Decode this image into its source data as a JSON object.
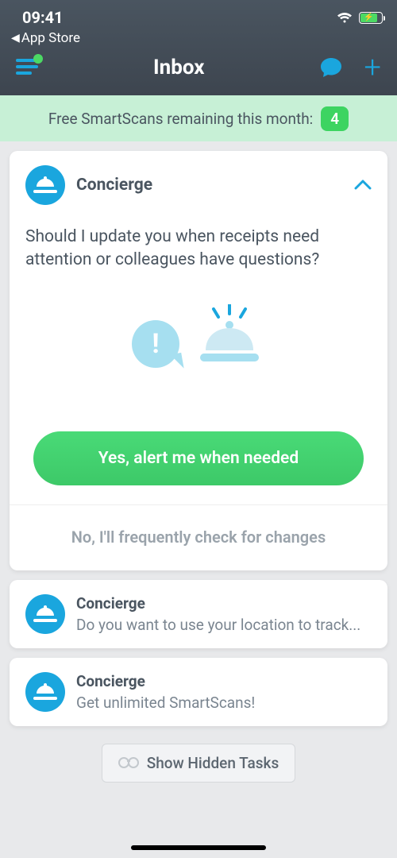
{
  "status": {
    "time": "09:41"
  },
  "back": {
    "label": "App Store"
  },
  "nav": {
    "title": "Inbox"
  },
  "banner": {
    "text": "Free SmartScans remaining this month:",
    "count": "4"
  },
  "card1": {
    "sender": "Concierge",
    "question": "Should I update you when receipts need attention or colleagues have questions?",
    "primary": "Yes, alert me when needed",
    "secondary": "No, I'll frequently check for changes"
  },
  "card2": {
    "sender": "Concierge",
    "preview": "Do you want to use your location to track..."
  },
  "card3": {
    "sender": "Concierge",
    "preview": "Get unlimited SmartScans!"
  },
  "hidden": {
    "label": "Show Hidden Tasks"
  }
}
